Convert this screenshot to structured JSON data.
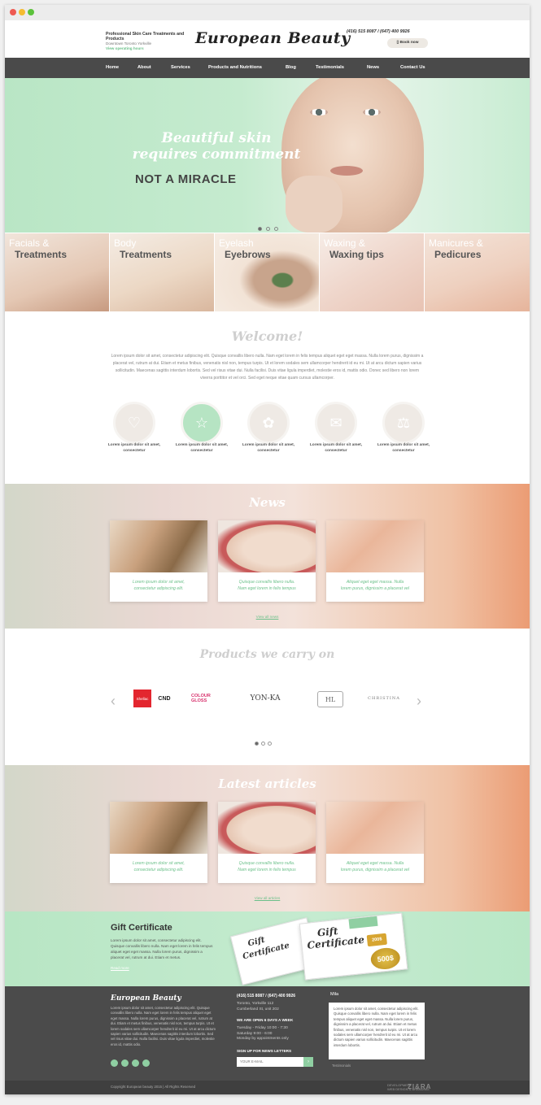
{
  "header": {
    "tagline": "Professional Skin Care Treatments and Products",
    "address": "Downtown Toronto Yorkville",
    "hours_link": "View operating hours",
    "logo": "European Beauty",
    "phones": "(416) 515 8087 / (647) 400 9926",
    "book_label": "Book now"
  },
  "nav": [
    "Home",
    "About",
    "Services",
    "Products and Nutritions",
    "Blog",
    "Testimonials",
    "News",
    "Contact Us"
  ],
  "hero": {
    "script_line1": "Beautiful skin",
    "script_line2": "requires commitment",
    "headline": "NOT A MIRACLE",
    "slide_active": 1,
    "slide_count": 3
  },
  "services": [
    {
      "line1": "Facials &",
      "line2": "Treatments"
    },
    {
      "line1": "Body",
      "line2": "Treatments"
    },
    {
      "line1": "Eyelash",
      "line2": "Eyebrows"
    },
    {
      "line1": "Waxing &",
      "line2": "Waxing tips"
    },
    {
      "line1": "Manicures &",
      "line2": "Pedicures"
    }
  ],
  "welcome": {
    "title": "Welcome!",
    "text": "Lorem ipsum dolor sit amet, consectetur adipiscing elit. Quisque convallis libero nulla. Nam eget lorem in felis tempus aliquet eget eget massa. Nulla lorem purus, dignissim a placerat vel, rutrum at dui. Etiam et metus finibus, venenatis nisl non, tempus turpis. Ut et lorem sodales sem ullamcorper hendrerit id eu mi. Ut at arcu dictum sapien varius sollicitudin. Maecenas sagittis interdum lobortis. Sed vel risus vitae dui. Nulla facilisi. Duis vitae ligula imperdiet, molestie eros id, mattis odio. Donec sed libero non lorem viverra porttitor et vel orci. Sed eget neque vitae quam cursus ullamcorper.",
    "features": [
      {
        "icon": "heart-icon",
        "glyph": "♡",
        "label": "Lorem ipsum dolor sit amet, consectetur",
        "active": false
      },
      {
        "icon": "star-icon",
        "glyph": "☆",
        "label": "Lorem ipsum dolor sit amet, consectetur",
        "active": true
      },
      {
        "icon": "muscle-icon",
        "glyph": "✿",
        "label": "Lorem ipsum dolor sit amet, consectetur",
        "active": false
      },
      {
        "icon": "gift-icon",
        "glyph": "✉",
        "label": "Lorem ipsum dolor sit amet, consectetur",
        "active": false
      },
      {
        "icon": "scales-icon",
        "glyph": "⚖",
        "label": "Lorem ipsum dolor sit amet, consectetur",
        "active": false
      }
    ]
  },
  "news": {
    "title": "News",
    "items": [
      {
        "line1": "Lorem ipsum dolor sit amet,",
        "line2": "consectetur adipiscing elit."
      },
      {
        "line1": "Quisque convallis libero nulla.",
        "line2": "Nam eget lorem in felis tempus"
      },
      {
        "line1": "Aliquet eget eget massa. Nulla",
        "line2": "lorem purus, dignissim a placerat vel"
      }
    ],
    "view_all": "View all news"
  },
  "products": {
    "title": "Products we carry on",
    "brands": [
      "Shellac",
      "CND",
      "COLOUR GLOSS",
      "YON-KA",
      "HL",
      "CHRISTINA"
    ],
    "slide_active": 1,
    "slide_count": 3
  },
  "articles": {
    "title": "Latest articles",
    "items": [
      {
        "line1": "Lorem ipsum dolor sit amet,",
        "line2": "consectetur adipiscing elit."
      },
      {
        "line1": "Quisque convallis libero nulla.",
        "line2": "Nam eget lorem in felis tempus"
      },
      {
        "line1": "Aliquet eget eget massa. Nulla",
        "line2": "lorem purus, dignissim a placerat vel"
      }
    ],
    "view_all": "View all articles"
  },
  "gift": {
    "title": "Gift Certificate",
    "text": "Lorem ipsum dolor sit amet, consectetur adipiscing elit. Quisque convallis libero nulla. Nam eget lorem in felis tempus aliquet eget eget massa. Nulla lorem purus, dignissim a placerat vel, rutrum at dui. Etiam et metus.",
    "more": "Read more",
    "card_word1": "Gift",
    "card_word2": "Certificate",
    "amount_small": "200$",
    "amount_large": "500$"
  },
  "footer": {
    "logo": "European Beauty",
    "about": "Lorem ipsum dolor sit amet, consectetur adipiscing elit. Quisque convallis libero nulla. Nam eget lorem in felis tempus aliquet eget eget massa. Nulla lorem purus, dignissim a placerat vel, rutrum at dui. Etiam et metus finibus, venenatis nisl non, tempus turpis. Ut et lorem sodales sem ullamcorper hendrerit id eu mi. Ut at arcu dictum sapien varius sollicitudin. Maecenas sagittis interdum lobortis. Sed vel risus vitae dui. Nulla facilisi. Duis vitae ligula imperdiet, molestie eros id, mattis odio.",
    "phones": "(416) 515 8087 / (647) 400 9926",
    "address_line1": "Toronto, Yorkville 112",
    "address_line2": "Cumberland St, unit 202",
    "open_title": "WE ARE OPEN 6 DAYS A WEEK",
    "hours_line1": "Tuesday - Friday 10:00 - 7:30",
    "hours_line2": "Saturday 9:00 - 6:00",
    "hours_line3": "Monday by appointments only",
    "signup_title": "SIGN UP FOR NEWS LETTERS",
    "email_placeholder": "YOUR E-MAIL",
    "testimonial_name": "Mila",
    "testimonial_text": "Lorem ipsum dolor sit amet, consectetur adipiscing elit. Quisque convallis libero nulla. Nam eget lorem in felis tempus aliquet eget eget massa. Nulla lorem purus, dignissim a placerat vel, rutrum at dui. Etiam et metus finibus, venenatis nisl non, tempus turpis. Ut et lorem sodales sem ullamcorper hendrerit id eu mi. Ut at arcu dictum sapien varius sollicitudin. Maecenas sagittis interdum lobortis.",
    "testimonials_link": "Testimonials",
    "copyright": "Copyright European beauty 2015 | All Rights Reserved",
    "developer_line1": "DEVELOPMENT",
    "developer_line2": "WEB DESIGN & BRANDING",
    "developer_logo": "ZI&RA"
  },
  "colors": {
    "accent": "#8fcfa2",
    "hero_bg": "#c5ebcf",
    "nav_bg": "#4a4a4a",
    "footer_bg": "#4b4b4b"
  }
}
